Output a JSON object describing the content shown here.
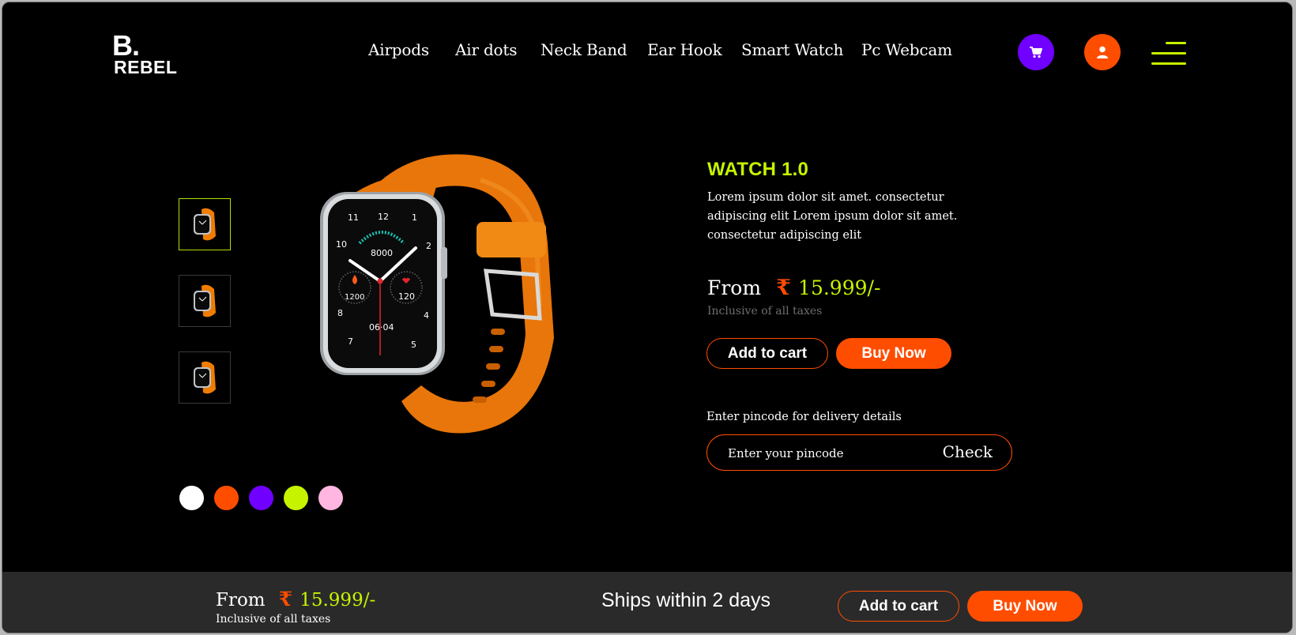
{
  "brand": {
    "logo_top": "B.",
    "logo_bottom": "REBEL"
  },
  "nav": {
    "items": [
      {
        "label": "Airpods"
      },
      {
        "label": "Air dots"
      },
      {
        "label": "Neck Band"
      },
      {
        "label": "Ear Hook"
      },
      {
        "label": "Smart Watch"
      },
      {
        "label": "Pc Webcam"
      }
    ]
  },
  "header_actions": {
    "cart_icon": "cart-icon",
    "user_icon": "user-icon",
    "menu_icon": "hamburger-icon"
  },
  "gallery": {
    "thumbnails": 3,
    "active_thumbnail": 0,
    "watch_face": {
      "hours": [
        "12",
        "1",
        "2",
        "4",
        "5",
        "7",
        "8",
        "10",
        "11"
      ],
      "steps": "8000",
      "calories": "1200",
      "heart_rate": "120",
      "date": "06·04"
    },
    "colors": [
      "#ffffff",
      "#ff4d00",
      "#7000ff",
      "#c6f400",
      "#ffb6e1"
    ]
  },
  "product": {
    "title": "WATCH 1.0",
    "description": "Lorem ipsum dolor sit amet. consectetur adipiscing elit Lorem ipsum dolor sit amet. consectetur adipiscing elit",
    "price_from": "From",
    "currency": "₹",
    "price": "15.999/-",
    "tax_note": "Inclusive of all taxes",
    "add_to_cart": "Add to cart",
    "buy_now": "Buy Now"
  },
  "pincode": {
    "label": "Enter pincode for delivery details",
    "placeholder": "Enter your pincode",
    "check": "Check"
  },
  "bottom_bar": {
    "price_from": "From",
    "currency": "₹",
    "price": "15.999/-",
    "tax_note": "Inclusive of all taxes",
    "shipping": "Ships within 2 days",
    "add_to_cart": "Add to cart",
    "buy_now": "Buy Now"
  },
  "theme": {
    "accent_orange": "#ff4d00",
    "accent_lime": "#c6f400",
    "accent_purple": "#7000ff"
  }
}
